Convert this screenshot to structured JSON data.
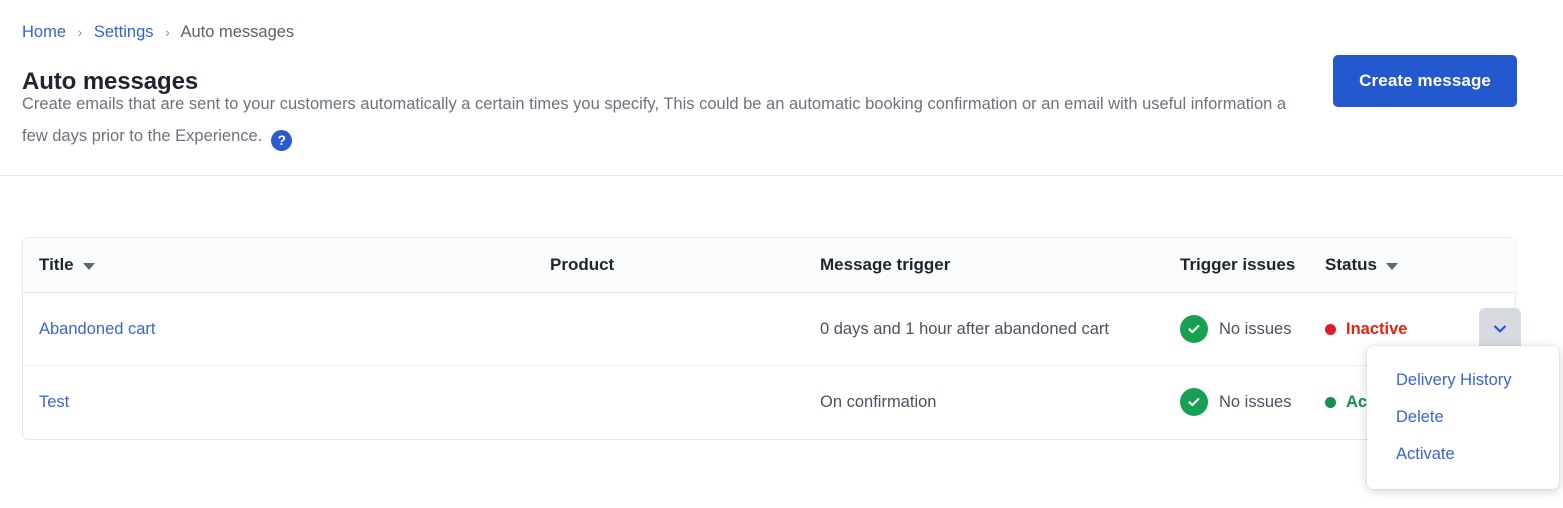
{
  "breadcrumb": {
    "items": [
      {
        "label": "Home",
        "link": true
      },
      {
        "label": "Settings",
        "link": true
      },
      {
        "label": "Auto messages",
        "link": false
      }
    ],
    "separator": "›"
  },
  "header": {
    "title": "Auto messages",
    "description": "Create emails that are sent to your customers automatically a certain times you specify, This could be an automatic booking confirmation or an email with useful information a few days prior to the Experience.",
    "help_icon": "question-mark-icon",
    "help_icon_glyph": "?",
    "create_button": "Create message"
  },
  "table": {
    "columns": [
      {
        "label": "Title",
        "sortable": true
      },
      {
        "label": "Product",
        "sortable": false
      },
      {
        "label": "Message trigger",
        "sortable": false
      },
      {
        "label": "Trigger issues",
        "sortable": false
      },
      {
        "label": "Status",
        "sortable": true
      }
    ],
    "rows": [
      {
        "title": "Abandoned cart",
        "product": "",
        "trigger": "0 days and 1 hour after abandoned cart",
        "issues": "No issues",
        "issues_icon": "check-circle-icon",
        "status": "Inactive",
        "status_state": "inactive"
      },
      {
        "title": "Test",
        "product": "",
        "trigger": "On confirmation",
        "issues": "No issues",
        "issues_icon": "check-circle-icon",
        "status": "Active",
        "status_state": "active"
      }
    ]
  },
  "row_menu": {
    "items": [
      {
        "label": "Delivery History"
      },
      {
        "label": "Delete"
      },
      {
        "label": "Activate"
      }
    ]
  },
  "colors": {
    "primary": "#2358cf",
    "link": "#3a63d4",
    "success": "#18a052",
    "danger": "#e8230f",
    "text": "#4a5261",
    "heading": "#1f2430"
  }
}
